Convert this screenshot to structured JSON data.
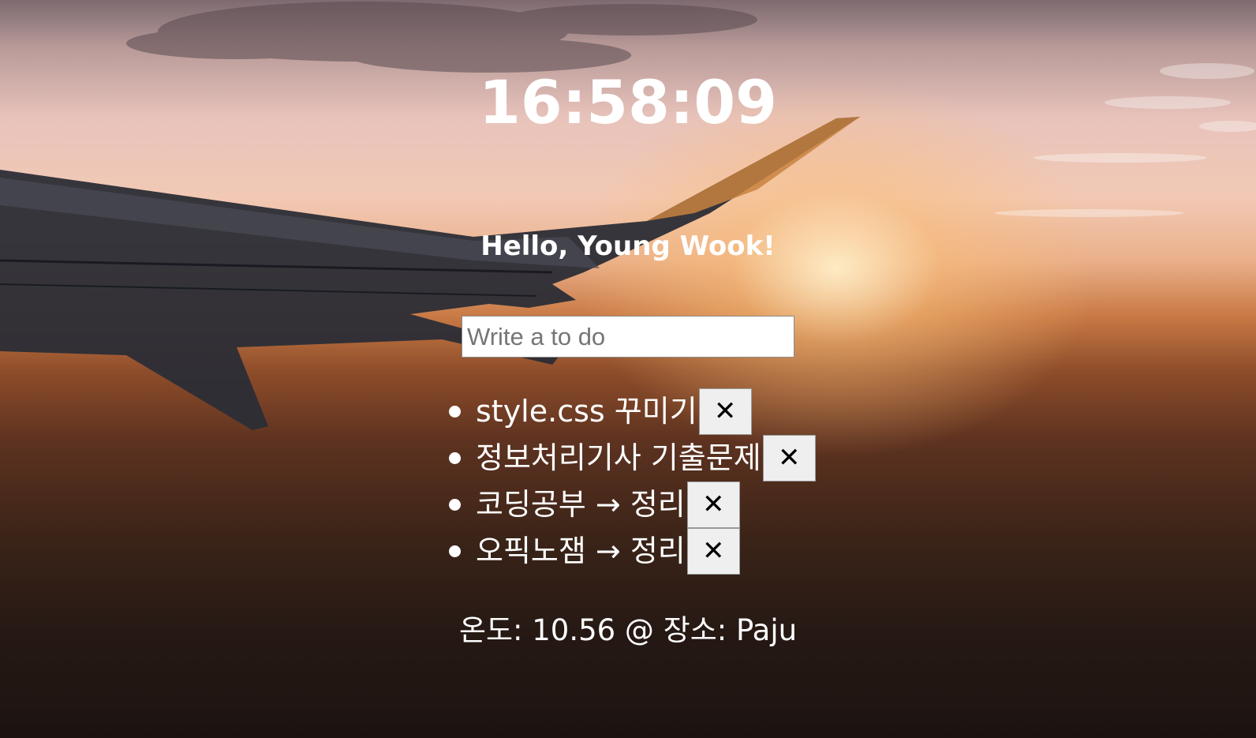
{
  "clock": {
    "time": "16:58:09"
  },
  "greeting": {
    "text": "Hello, Young Wook!"
  },
  "todo_form": {
    "placeholder": "Write a to do",
    "value": ""
  },
  "todos": [
    {
      "text": "style.css 꾸미기",
      "delete_label": "✕"
    },
    {
      "text": "정보처리기사 기출문제",
      "delete_label": "✕"
    },
    {
      "text": "코딩공부 → 정리",
      "delete_label": "✕"
    },
    {
      "text": "오픽노잼 → 정리",
      "delete_label": "✕"
    }
  ],
  "weather": {
    "text": "온도: 10.56 @ 장소: Paju"
  },
  "background": {
    "description_icon": "sunset-airplane-wing-image",
    "colors": {
      "sky_top": "#7d6a70",
      "sky_glow": "#f2c9b5",
      "sun": "#ffeec8",
      "ground": "#1c1310",
      "wing": "#2b2d36"
    }
  }
}
